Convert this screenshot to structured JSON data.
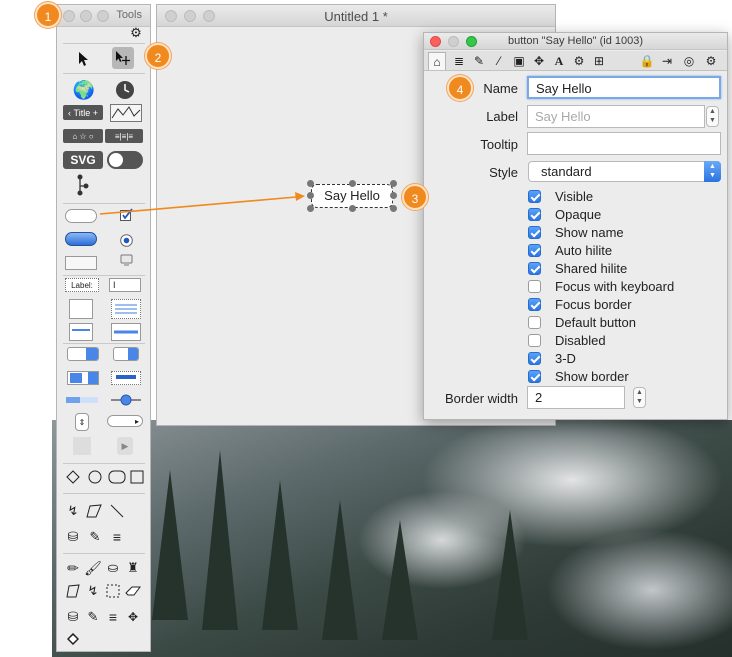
{
  "tools_window": {
    "title": "Tools"
  },
  "untitled_window": {
    "title": "Untitled 1 *"
  },
  "canvas_button": {
    "label": "Say Hello"
  },
  "inspector": {
    "title": "button \"Say Hello\" (id 1003)",
    "fields": {
      "name_label": "Name",
      "name_value": "Say Hello",
      "label_label": "Label",
      "label_placeholder": "Say Hello",
      "tooltip_label": "Tooltip",
      "tooltip_value": "",
      "style_label": "Style",
      "style_value": "standard",
      "border_width_label": "Border width",
      "border_width_value": "2"
    },
    "checkboxes": [
      {
        "label": "Visible",
        "checked": true
      },
      {
        "label": "Opaque",
        "checked": true
      },
      {
        "label": "Show name",
        "checked": true
      },
      {
        "label": "Auto hilite",
        "checked": true
      },
      {
        "label": "Shared hilite",
        "checked": true
      },
      {
        "label": "Focus with keyboard",
        "checked": false
      },
      {
        "label": "Focus border",
        "checked": true
      },
      {
        "label": "Default button",
        "checked": false
      },
      {
        "label": "Disabled",
        "checked": false
      },
      {
        "label": "3-D",
        "checked": true
      },
      {
        "label": "Show border",
        "checked": true
      }
    ]
  },
  "tool_labels": {
    "title_widget": "Title",
    "svg_widget": "SVG",
    "label_field": "Label:"
  },
  "callouts": [
    "1",
    "2",
    "3",
    "4"
  ],
  "colors": {
    "accent_orange": "#f0891e",
    "checkbox_blue": "#2c76e1",
    "close_red": "#fc605c",
    "minimize_yellow": "#fdbc40",
    "zoom_green": "#34c84a"
  }
}
